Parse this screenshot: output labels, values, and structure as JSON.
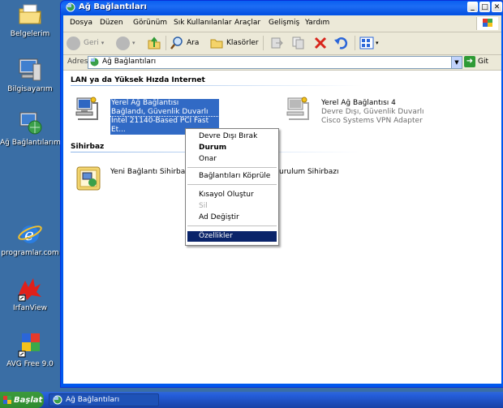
{
  "desktop": {
    "icons": [
      {
        "label": "Belgelerim"
      },
      {
        "label": "Bilgisayarım"
      },
      {
        "label": "Ağ Bağlantılarım"
      },
      {
        "label": "programlar.com"
      },
      {
        "label": "IrfanView"
      },
      {
        "label": "AVG Free 9.0"
      }
    ]
  },
  "window": {
    "title": "Ağ Bağlantıları",
    "menu": [
      "Dosya",
      "Düzen",
      "Görünüm",
      "Sık Kullanılanlar",
      "Araçlar",
      "Gelişmiş",
      "Yardım"
    ],
    "toolbar": {
      "back": "Geri",
      "search": "Ara",
      "folders": "Klasörler"
    },
    "address": {
      "label": "Adres",
      "value": "Ağ Bağlantıları",
      "go": "Git"
    }
  },
  "content": {
    "lan_group_title": "LAN ya da Yüksek Hızda Internet",
    "connections": [
      {
        "name": "Yerel Ağ Bağlantısı",
        "status": "Bağlandı, Güvenlik Duvarlı",
        "device": "Intel 21140-Based PCI Fast Et..."
      },
      {
        "name": "Yerel Ağ Bağlantısı 4",
        "status": "Devre Dışı, Güvenlik Duvarlı",
        "device": "Cisco Systems VPN Adapter"
      }
    ],
    "wizard_group_title": "Sihirbaz",
    "wizards": [
      {
        "name": "Yeni Bağlantı Sihirbazı"
      },
      {
        "name": "urulum Sihirbazı"
      }
    ]
  },
  "context_menu": {
    "items": [
      {
        "label": "Devre Dışı Bırak"
      },
      {
        "label": "Durum"
      },
      {
        "label": "Onar"
      },
      {
        "label": "Bağlantıları Köprüle"
      },
      {
        "label": "Kısayol Oluştur"
      },
      {
        "label": "Sil"
      },
      {
        "label": "Ad Değiştir"
      },
      {
        "label": "Özellikler"
      }
    ]
  },
  "taskbar": {
    "start": "Başlat",
    "task": "Ağ Bağlantıları"
  },
  "colors": {
    "desktop": "#3a6ea5",
    "title_blue": "#0a5ff1",
    "selection": "#316ac5",
    "menu_highlight": "#0a246a"
  }
}
